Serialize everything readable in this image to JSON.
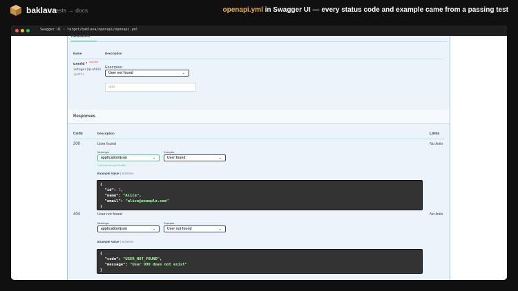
{
  "topbar": {
    "brand": "baklava",
    "crumb": "tests → docs",
    "headline_highlight": "openapi.yml",
    "headline_rest": " in Swagger UI — every status code and example came from a passing test",
    "logo_icon": "package-box-icon"
  },
  "window": {
    "title": "Swagger UI - target/baklava/openapi/openapi.yml"
  },
  "parameters": {
    "tab_label": "Parameters",
    "col_name": "Name",
    "col_description": "Description",
    "param": {
      "name": "userId",
      "required_star": "*",
      "required_label": "required",
      "type": "integer($int64)",
      "location": "(path)",
      "examples_label": "Examples:",
      "selected_example": "User not found",
      "input_value": "999"
    }
  },
  "responses": {
    "title": "Responses",
    "col_code": "Code",
    "col_description": "Description",
    "col_links": "Links",
    "media_type_label": "Media type",
    "examples_label": "Examples",
    "tab_example": "Example Value",
    "tab_divider": "|",
    "tab_schema": "Schema",
    "controls_note": "Controls Accept header.",
    "items": [
      {
        "code": "200",
        "description": "User found",
        "links": "No links",
        "media_type": "application/json",
        "example": "User found",
        "json_lines": [
          {
            "text": "{",
            "parts": null
          },
          {
            "key": "\"id\"",
            "value": "1",
            "kind": "num",
            "comma": ","
          },
          {
            "key": "\"name\"",
            "value": "\"Alice\"",
            "kind": "str",
            "comma": ","
          },
          {
            "key": "\"email\"",
            "value": "\"alice@example.com\"",
            "kind": "str",
            "comma": ""
          },
          {
            "text": "}",
            "parts": null
          }
        ]
      },
      {
        "code": "404",
        "description": "User not found",
        "links": "No links",
        "media_type": "application/json",
        "example": "User not found",
        "json_lines": [
          {
            "text": "{",
            "parts": null
          },
          {
            "key": "\"code\"",
            "value": "\"USER_NOT_FOUND\"",
            "kind": "str",
            "comma": ","
          },
          {
            "key": "\"message\"",
            "value": "\"User 999 does not exist\"",
            "kind": "str",
            "comma": ""
          },
          {
            "text": "}",
            "parts": null
          }
        ]
      }
    ]
  },
  "colors": {
    "accent_green": "#49cc90",
    "headline_highlight": "#f2b53c",
    "op_background": "#ebf3fb",
    "code_background": "#333333"
  }
}
